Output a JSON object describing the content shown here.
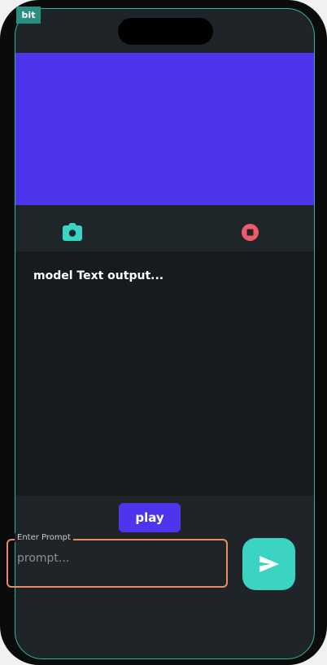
{
  "app": {
    "debug_badge": "bit"
  },
  "controls": {
    "camera_icon": "camera-icon",
    "stop_icon": "stop-icon",
    "camera_color": "#3bd3c1",
    "stop_color": "#f05a6a"
  },
  "output": {
    "text": "model Text output..."
  },
  "actions": {
    "play_label": "play"
  },
  "prompt": {
    "label": "Enter Prompt",
    "placeholder": "prompt...",
    "value": ""
  },
  "send": {
    "icon": "send-icon",
    "color": "#3bd3c1"
  },
  "colors": {
    "accent": "#4c35ec",
    "teal": "#3bd3c1",
    "prompt_border": "#e58d64"
  }
}
